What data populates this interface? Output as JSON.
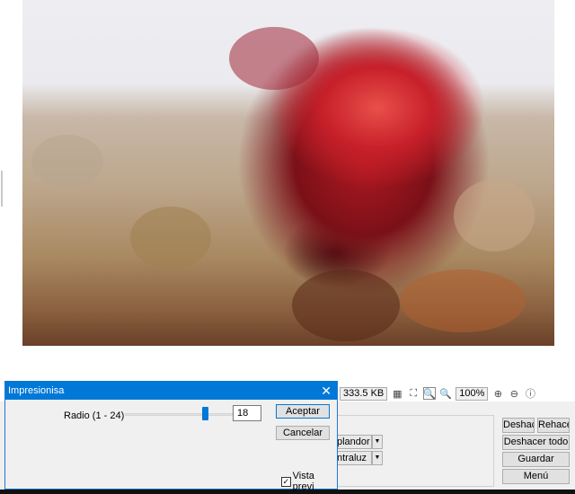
{
  "toolbar": {
    "file_size": "333.5 KB",
    "zoom": "100%"
  },
  "effects_panel": {
    "dropdown1": "plandor",
    "dropdown2": "ntraluz"
  },
  "actions": {
    "undo": "Deshacer",
    "redo": "Rehacer",
    "undo_all": "Deshacer todo",
    "save": "Guardar",
    "menu": "Menú"
  },
  "dialog": {
    "title": "Impresionisa",
    "radius_label": "Radio (1 - 24)",
    "radius_value": "18",
    "radius_min": 1,
    "radius_max": 24,
    "accept": "Aceptar",
    "cancel": "Cancelar",
    "preview_label": "Vista previ",
    "preview_checked": true
  },
  "colors": {
    "accent": "#0078d7"
  }
}
